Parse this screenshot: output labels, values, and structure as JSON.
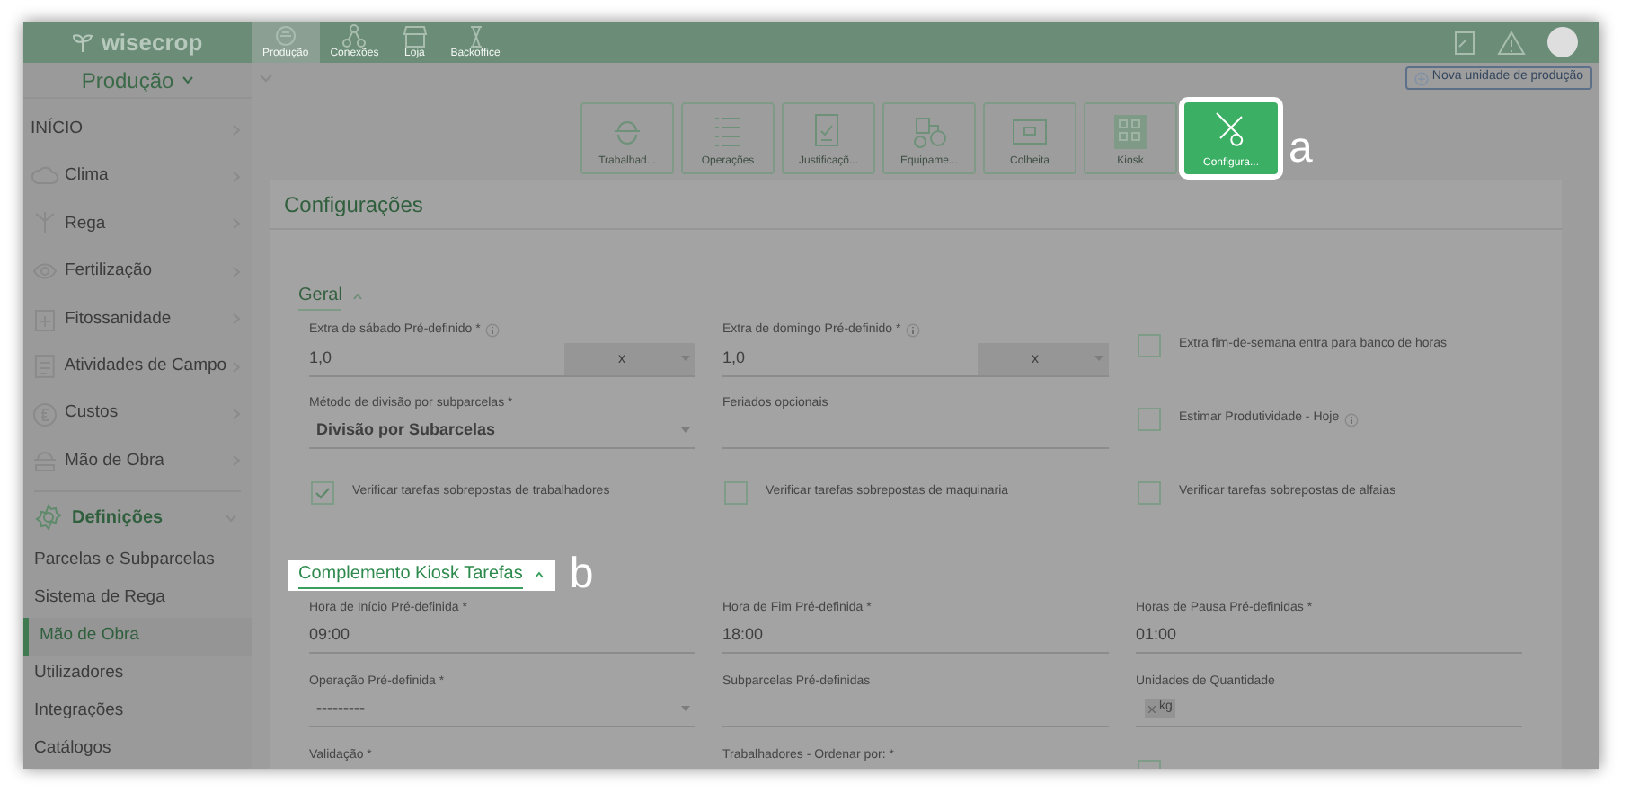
{
  "top_bar": {
    "logo": "wisecrop",
    "apps": [
      {
        "label": "Produção",
        "selected": true
      },
      {
        "label": "Conexões",
        "selected": false
      },
      {
        "label": "Loja",
        "selected": false
      },
      {
        "label": "Backoffice",
        "selected": false
      }
    ]
  },
  "unit_selector": "Produção",
  "new_unit_button": "Nova unidade de produção",
  "sidebar": {
    "items": [
      {
        "label": "INÍCIO"
      },
      {
        "label": "Clima"
      },
      {
        "label": "Rega"
      },
      {
        "label": "Fertilização"
      },
      {
        "label": "Fitossanidade"
      },
      {
        "label": "Atividades de Campo"
      },
      {
        "label": "Custos"
      },
      {
        "label": "Mão de Obra"
      }
    ],
    "section": {
      "label": "Definições",
      "expanded": true,
      "children": [
        {
          "label": "Parcelas e Subparcelas",
          "selected": false
        },
        {
          "label": "Sistema de Rega",
          "selected": false
        },
        {
          "label": "Mão de Obra",
          "selected": true
        },
        {
          "label": "Utilizadores",
          "selected": false
        },
        {
          "label": "Integrações",
          "selected": false
        },
        {
          "label": "Catálogos",
          "selected": false
        }
      ]
    }
  },
  "toolbar": [
    {
      "label": "Trabalhad...",
      "selected": false
    },
    {
      "label": "Operações",
      "selected": false
    },
    {
      "label": "Justificaçõ...",
      "selected": false
    },
    {
      "label": "Equipame...",
      "selected": false
    },
    {
      "label": "Colheita",
      "selected": false
    },
    {
      "label": "Kiosk",
      "selected": false
    },
    {
      "label": "Configura...",
      "selected": true,
      "callout": "a"
    }
  ],
  "panel": {
    "title": "Configurações",
    "sections": [
      {
        "title": "Geral",
        "expanded": true,
        "highlighted": false,
        "fields": [
          {
            "kind": "multiplier",
            "label": "Extra de sábado Pré-definido *",
            "info": true,
            "value": "1,0",
            "unit": "x"
          },
          {
            "kind": "multiplier",
            "label": "Extra de domingo Pré-definido *",
            "info": true,
            "value": "1,0",
            "unit": "x"
          },
          {
            "kind": "checkbox",
            "label": "Extra fim-de-semana entra para banco de horas",
            "checked": false
          },
          {
            "kind": "select",
            "label": "Método de divisão por subparcelas *",
            "value": "Divisão por Subarcelas"
          },
          {
            "kind": "text",
            "label": "Feriados opcionais"
          },
          {
            "kind": "checkbox",
            "label": "Estimar Produtividade - Hoje",
            "checked": false,
            "info": true
          },
          {
            "kind": "checkbox",
            "label": "Verificar tarefas sobrepostas de trabalhadores",
            "checked": true
          },
          {
            "kind": "checkbox",
            "label": "Verificar tarefas sobrepostas de maquinaria",
            "checked": false
          },
          {
            "kind": "checkbox",
            "label": "Verificar tarefas sobrepostas de alfaias",
            "checked": false
          }
        ]
      },
      {
        "title": "Complemento Kiosk Tarefas",
        "expanded": true,
        "highlighted": true,
        "callout": "b",
        "fields": [
          {
            "kind": "text",
            "label": "Hora de Início Pré-definida *",
            "value": "09:00"
          },
          {
            "kind": "text",
            "label": "Hora de Fim Pré-definida *",
            "value": "18:00"
          },
          {
            "kind": "text",
            "label": "Horas de Pausa Pré-definidas *",
            "value": "01:00"
          },
          {
            "kind": "select",
            "label": "Operação Pré-definida *",
            "value": "---------"
          },
          {
            "kind": "text",
            "label": "Subparcelas Pré-definidas"
          },
          {
            "kind": "chips",
            "label": "Unidades de Quantidade",
            "chips": [
              "kg"
            ]
          },
          {
            "kind": "text",
            "label": "Validação *"
          },
          {
            "kind": "text",
            "label": "Trabalhadores - Ordenar por: *"
          },
          {
            "kind": "checkbox",
            "checked": false
          }
        ]
      }
    ]
  }
}
